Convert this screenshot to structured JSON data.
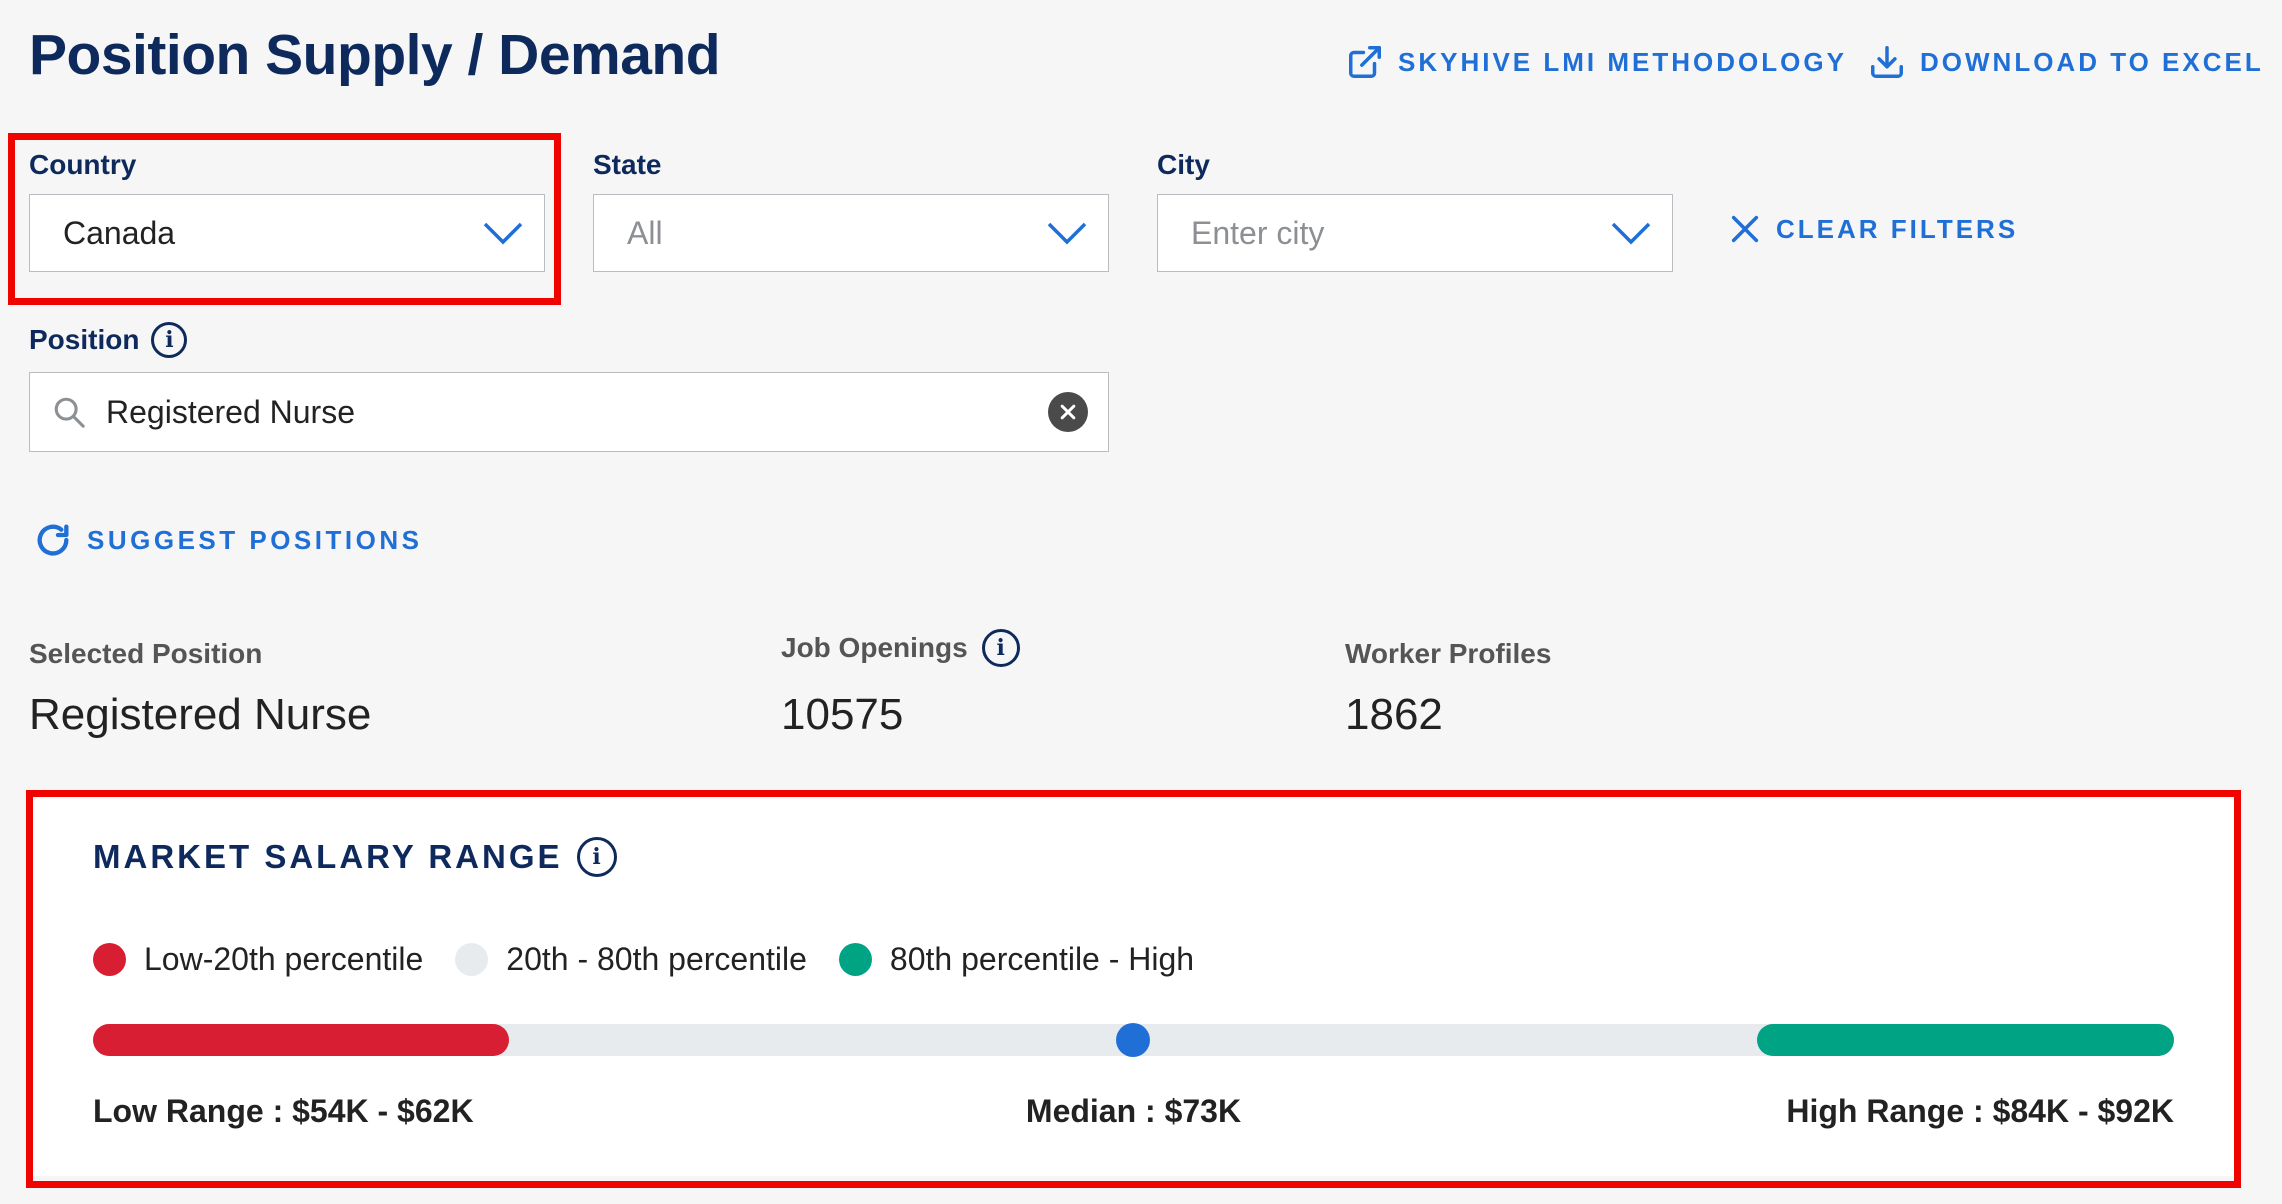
{
  "header": {
    "title": "Position Supply / Demand",
    "methodology_label": "SKYHIVE LMI METHODOLOGY",
    "download_label": "DOWNLOAD TO EXCEL"
  },
  "filters": {
    "country": {
      "label": "Country",
      "value": "Canada"
    },
    "state": {
      "label": "State",
      "placeholder": "All"
    },
    "city": {
      "label": "City",
      "placeholder": "Enter city"
    },
    "clear_label": "CLEAR FILTERS"
  },
  "position": {
    "label": "Position",
    "value": "Registered Nurse",
    "suggest_label": "SUGGEST POSITIONS"
  },
  "stats": {
    "selected_position": {
      "label": "Selected Position",
      "value": "Registered Nurse"
    },
    "job_openings": {
      "label": "Job Openings",
      "value": "10575"
    },
    "worker_profiles": {
      "label": "Worker Profiles",
      "value": "1862"
    }
  },
  "salary": {
    "title": "MARKET SALARY RANGE",
    "legend": [
      {
        "label": "Low-20th percentile",
        "color": "#d81e33"
      },
      {
        "label": "20th - 80th percentile",
        "color": "#e8ebee"
      },
      {
        "label": "80th percentile - High",
        "color": "#00a383"
      }
    ],
    "low_range": "Low Range : $54K - $62K",
    "median": "Median : $73K",
    "high_range": "High Range : $84K - $92K",
    "median_color": "#1f6fd6"
  }
}
